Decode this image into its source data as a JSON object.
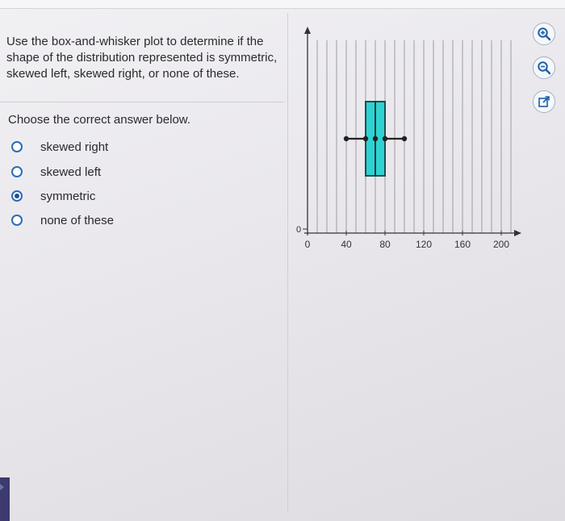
{
  "question": {
    "text": "Use the box-and-whisker plot to determine if the shape of the distribution represented is symmetric, skewed left, skewed right, or none of these.",
    "instruction": "Choose the correct answer below."
  },
  "options": [
    {
      "label": "skewed right",
      "selected": false
    },
    {
      "label": "skewed left",
      "selected": false
    },
    {
      "label": "symmetric",
      "selected": true
    },
    {
      "label": "none of these",
      "selected": false
    }
  ],
  "plot": {
    "y_tick_label": "0",
    "x_tick_labels": [
      "0",
      "40",
      "80",
      "120",
      "160",
      "200"
    ],
    "box_color": "#2fd2d2",
    "whisker_color": "#222222"
  },
  "chart_data": {
    "type": "boxplot",
    "xlim": [
      0,
      210
    ],
    "x_ticks": [
      0,
      40,
      80,
      120,
      160,
      200
    ],
    "min": 40,
    "q1": 60,
    "median": 70,
    "q3": 80,
    "max": 100,
    "grid": true
  },
  "tools": [
    {
      "icon": "zoom-in-icon"
    },
    {
      "icon": "zoom-out-icon"
    },
    {
      "icon": "open-in-new-window-icon"
    }
  ]
}
